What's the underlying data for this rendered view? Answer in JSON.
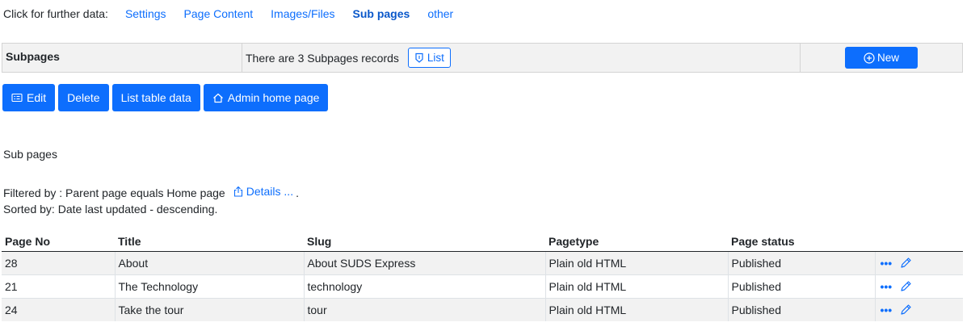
{
  "nav": {
    "lead": "Click for further data:",
    "links": [
      "Settings",
      "Page Content",
      "Images/Files",
      "Sub pages",
      "other"
    ]
  },
  "subpages_bar": {
    "title": "Subpages",
    "records_text": "There are 3 Subpages records",
    "list_label": "List",
    "new_label": "New"
  },
  "actions": {
    "edit": "Edit",
    "delete": "Delete",
    "list_table": "List table data",
    "admin_home": "Admin home page"
  },
  "section_title": "Sub pages",
  "filter": {
    "text": "Filtered by : Parent page equals Home page",
    "details_label": "Details ...",
    "trailing": ".",
    "sorted": "Sorted by: Date last updated - descending."
  },
  "table": {
    "headers": [
      "Page No",
      "Title",
      "Slug",
      "Pagetype",
      "Page status"
    ],
    "rows": [
      [
        "28",
        "About",
        "About SUDS Express",
        "Plain old HTML",
        "Published"
      ],
      [
        "21",
        "The Technology",
        "technology",
        "Plain old HTML",
        "Published"
      ],
      [
        "24",
        "Take the tour",
        "tour",
        "Plain old HTML",
        "Published"
      ]
    ],
    "more_icon": "ellipsis-icon",
    "edit_icon": "pencil-icon"
  },
  "colors": {
    "primary": "#0d6efd",
    "text": "#212529",
    "stripe": "#f2f2f2"
  }
}
